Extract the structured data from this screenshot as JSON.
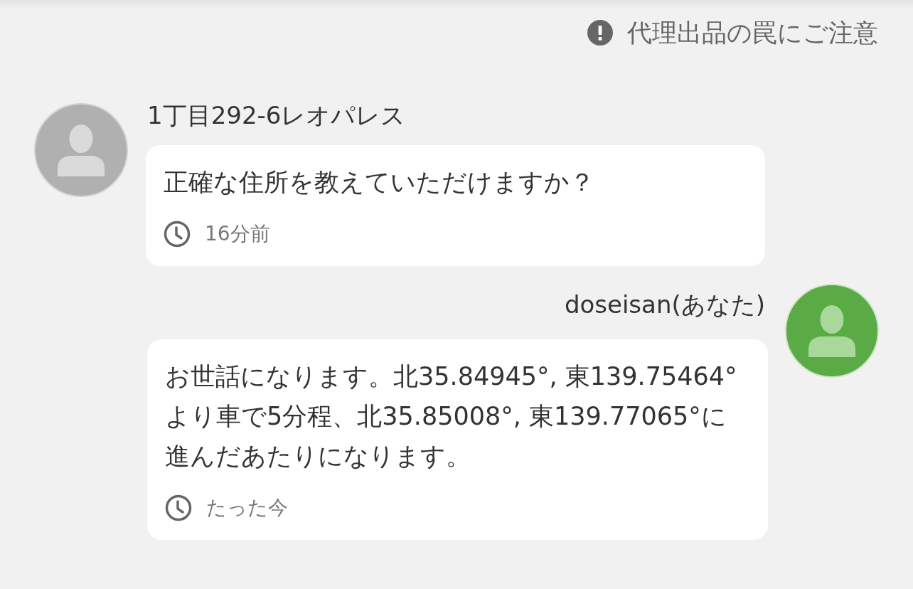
{
  "notice": {
    "text": "代理出品の罠にご注意"
  },
  "messages": [
    {
      "kind": "received",
      "sender": "1丁目292-6レオパレス",
      "text": "正確な住所を教えていただけますか？",
      "time": "16分前"
    },
    {
      "kind": "sent",
      "sender": "doseisan(あなた)",
      "text": "お世話になります。北35.84945°, 東139.75464°より車で5分程、北35.85008°, 東139.77065°に進んだあたりになります。",
      "time": "たった今"
    }
  ]
}
